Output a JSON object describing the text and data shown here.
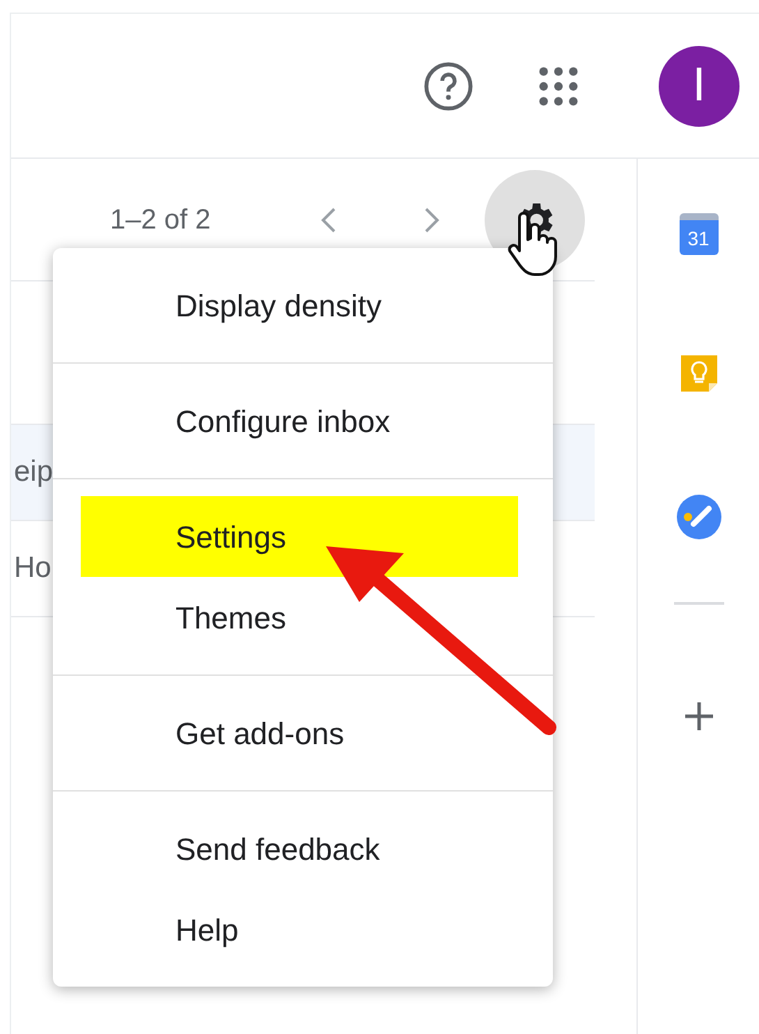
{
  "header": {
    "avatar_initial": "I"
  },
  "toolbar": {
    "count": "1–2 of 2"
  },
  "email_rows": [
    {
      "text": "eip",
      "shaded": true
    },
    {
      "text": "Ho",
      "shaded": false
    }
  ],
  "menu": {
    "groups": [
      [
        {
          "label": "Display density",
          "highlighted": false
        }
      ],
      [
        {
          "label": "Configure inbox",
          "highlighted": false
        }
      ],
      [
        {
          "label": "Settings",
          "highlighted": true
        },
        {
          "label": "Themes",
          "highlighted": false
        }
      ],
      [
        {
          "label": "Get add-ons",
          "highlighted": false
        }
      ],
      [
        {
          "label": "Send feedback",
          "highlighted": false
        },
        {
          "label": "Help",
          "highlighted": false
        }
      ]
    ]
  },
  "side_panel": {
    "calendar_day": "31"
  }
}
